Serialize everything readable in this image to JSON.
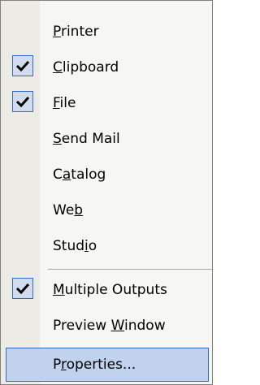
{
  "menu": {
    "items": [
      {
        "pre": "",
        "u": "P",
        "post": "rinter",
        "checked": false
      },
      {
        "pre": "",
        "u": "C",
        "post": "lipboard",
        "checked": true
      },
      {
        "pre": "",
        "u": "F",
        "post": "ile",
        "checked": true
      },
      {
        "pre": "",
        "u": "S",
        "post": "end Mail",
        "checked": false
      },
      {
        "pre": "C",
        "u": "a",
        "post": "talog",
        "checked": false
      },
      {
        "pre": "We",
        "u": "b",
        "post": "",
        "checked": false
      },
      {
        "pre": "Stud",
        "u": "i",
        "post": "o",
        "checked": false
      },
      {
        "pre": "",
        "u": "M",
        "post": "ultiple Outputs",
        "checked": true
      },
      {
        "pre": "Preview ",
        "u": "W",
        "post": "indow",
        "checked": false
      },
      {
        "pre": "P",
        "u": "r",
        "post": "operties...",
        "checked": false,
        "highlighted": true
      }
    ]
  },
  "colors": {
    "highlight_bg": "#c1d2ee",
    "highlight_border": "#316ac5",
    "gutter_bg": "#ecebe6",
    "menu_bg": "#f6f6f3"
  },
  "icons": {
    "check": "check-icon"
  }
}
